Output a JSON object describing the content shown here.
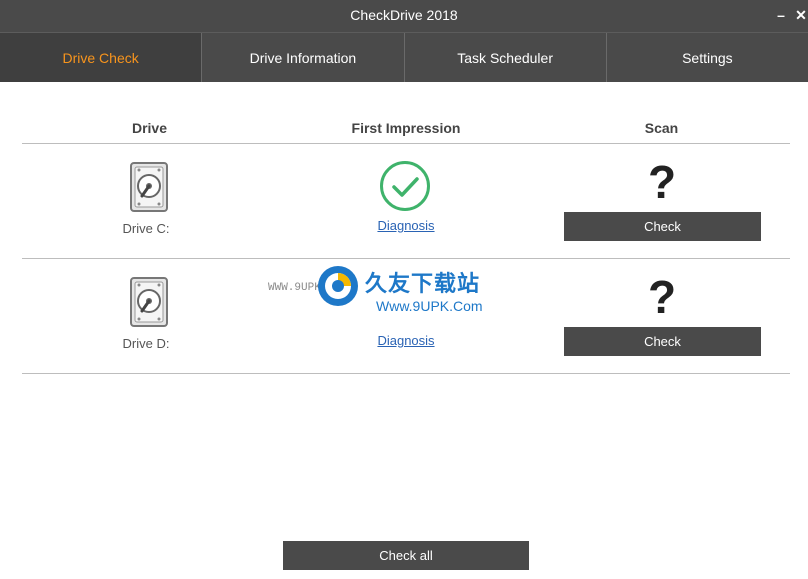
{
  "window": {
    "title": "CheckDrive 2018",
    "minimize": "–",
    "close": "✕"
  },
  "tabs": [
    {
      "label": "Drive Check",
      "active": true
    },
    {
      "label": "Drive Information",
      "active": false
    },
    {
      "label": "Task Scheduler",
      "active": false
    },
    {
      "label": "Settings",
      "active": false
    }
  ],
  "table": {
    "headers": {
      "drive": "Drive",
      "impression": "First Impression",
      "scan": "Scan"
    },
    "rows": [
      {
        "drive": "Drive C:",
        "status": "ok",
        "diagnosis": "Diagnosis",
        "scan": "?",
        "button": "Check"
      },
      {
        "drive": "Drive D:",
        "status": "unknown",
        "diagnosis": "Diagnosis",
        "scan": "?",
        "button": "Check"
      }
    ]
  },
  "footer": {
    "check_all": "Check all"
  },
  "watermark": {
    "url": "WWW.9UPK.COM",
    "title": "久友下载站",
    "subtitle": "Www.9UPK.Com"
  },
  "colors": {
    "accent": "#f7941d",
    "bar": "#4a4a4a",
    "ok": "#3fb36b",
    "link": "#2a63b4"
  }
}
